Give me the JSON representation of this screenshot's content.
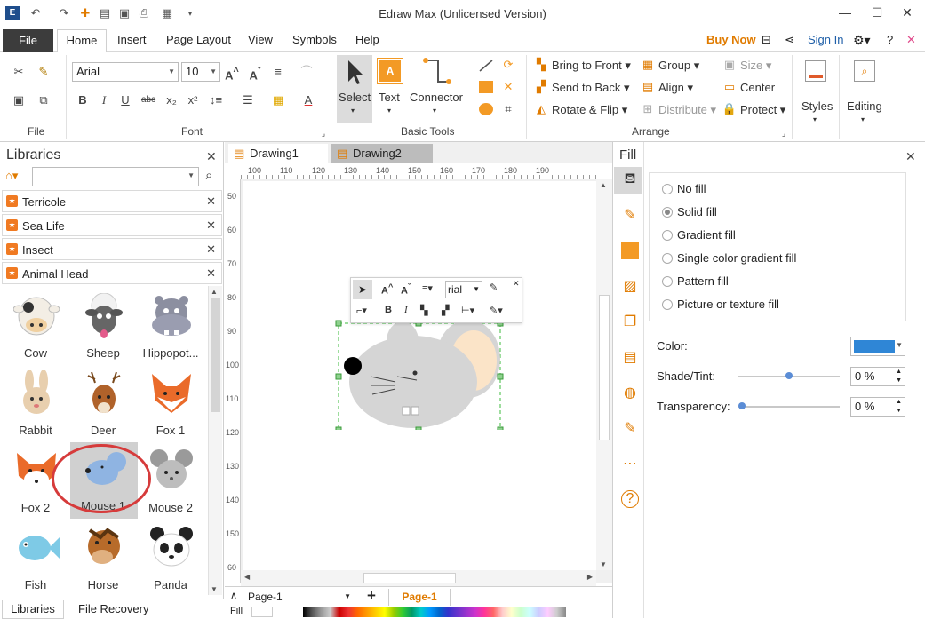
{
  "window": {
    "title": "Edraw Max (Unlicensed Version)"
  },
  "menu": {
    "file": "File",
    "home": "Home",
    "insert": "Insert",
    "page_layout": "Page Layout",
    "view": "View",
    "symbols": "Symbols",
    "help": "Help",
    "buy_now": "Buy Now",
    "sign_in": "Sign In"
  },
  "ribbon": {
    "groups": {
      "file": "File",
      "font": "Font",
      "basic_tools": "Basic Tools",
      "arrange": "Arrange"
    },
    "font_name": "Arial",
    "font_size": "10",
    "select": "Select",
    "text": "Text",
    "connector": "Connector",
    "bring_to_front": "Bring to Front",
    "send_to_back": "Send to Back",
    "rotate_flip": "Rotate & Flip",
    "group": "Group",
    "align": "Align",
    "distribute": "Distribute",
    "size": "Size",
    "center": "Center",
    "protect": "Protect",
    "styles": "Styles",
    "editing": "Editing"
  },
  "libraries": {
    "title": "Libraries",
    "categories": [
      "Terricole",
      "Sea Life",
      "Insect",
      "Animal Head"
    ],
    "shapes": [
      "Cow",
      "Sheep",
      "Hippopot...",
      "Rabbit",
      "Deer",
      "Fox 1",
      "Fox 2",
      "Mouse 1",
      "Mouse 2",
      "Fish",
      "Horse",
      "Panda"
    ],
    "bottom_tabs": [
      "Libraries",
      "File Recovery"
    ]
  },
  "canvas": {
    "tabs": [
      "Drawing1",
      "Drawing2"
    ],
    "hruler": [
      "100",
      "110",
      "120",
      "130",
      "140",
      "150",
      "160",
      "170",
      "180",
      "190"
    ],
    "vruler": [
      "50",
      "60",
      "70",
      "80",
      "90",
      "100",
      "110",
      "120",
      "130",
      "140",
      "150",
      "60"
    ],
    "page_select": "Page-1",
    "page_tab": "Page-1",
    "fill_label": "Fill",
    "mini_font": "rial"
  },
  "fill": {
    "title": "Fill",
    "options": [
      "No fill",
      "Solid fill",
      "Gradient fill",
      "Single color gradient fill",
      "Pattern fill",
      "Picture or texture fill"
    ],
    "color_label": "Color:",
    "shade_label": "Shade/Tint:",
    "shade_value": "0 %",
    "transparency_label": "Transparency:",
    "transparency_value": "0 %",
    "color_swatch": "#2f86d6"
  }
}
